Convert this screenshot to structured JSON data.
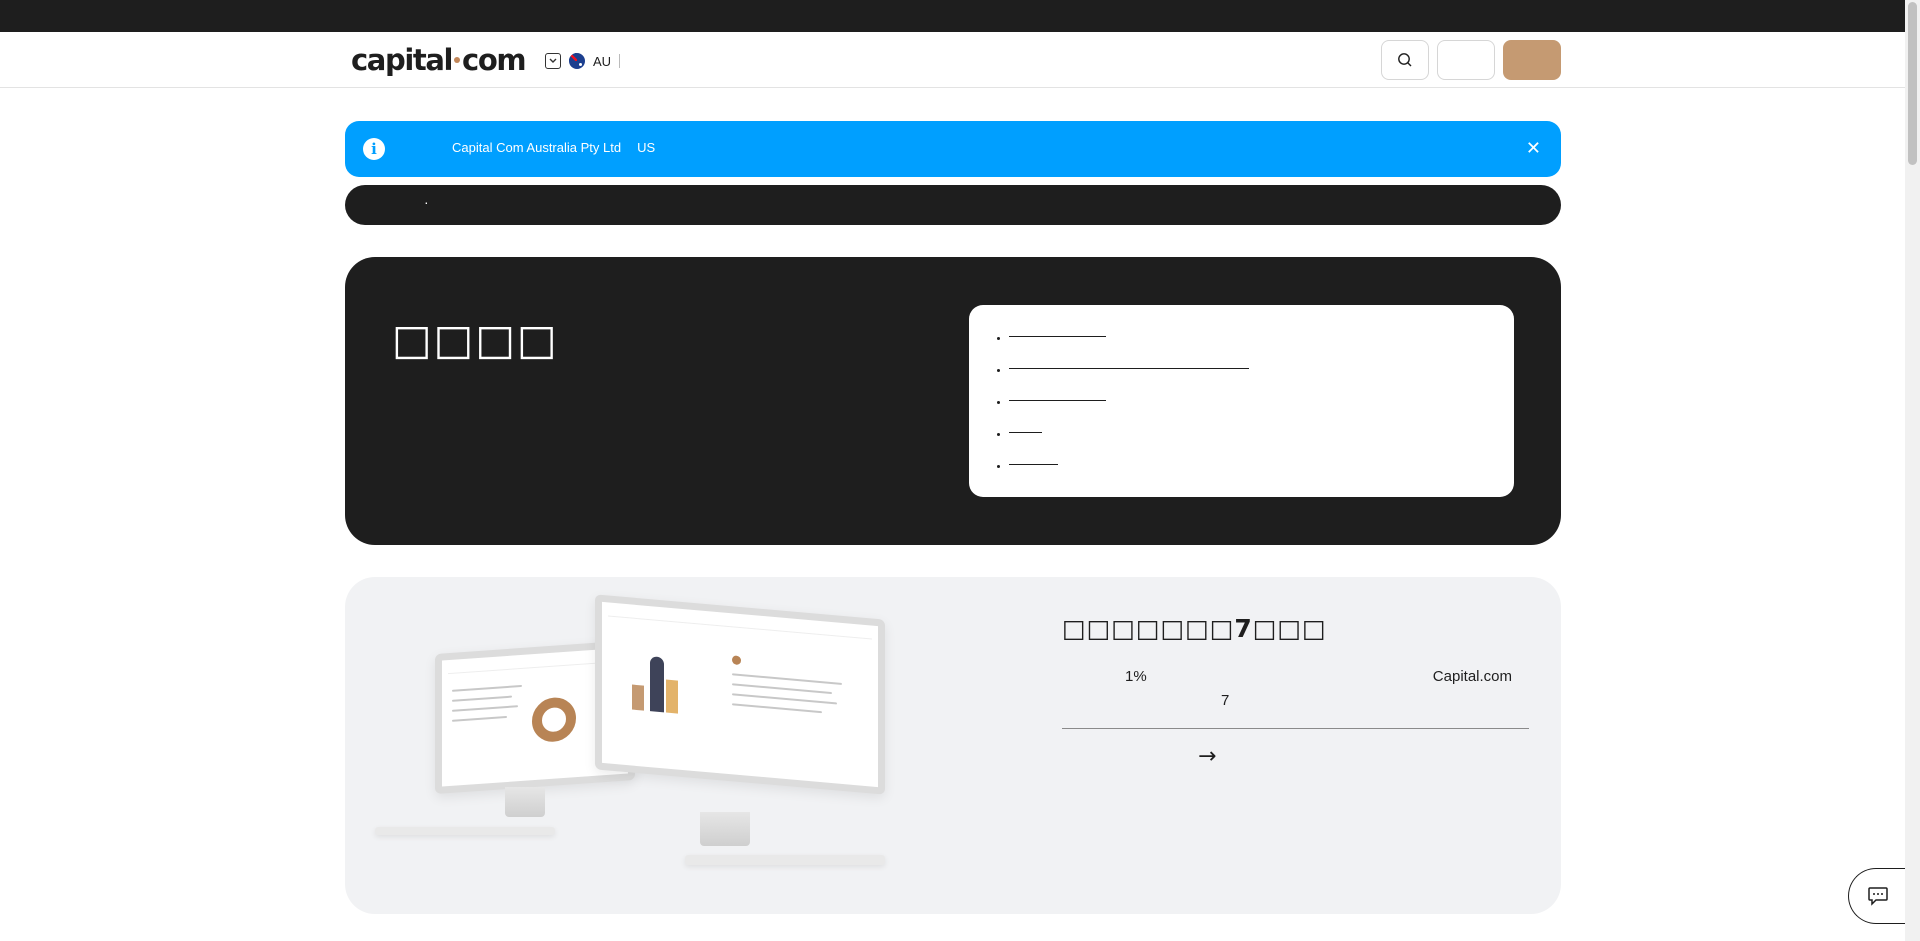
{
  "header": {
    "logo_left": "capital",
    "logo_right": "com",
    "region_code": "AU",
    "icons": {
      "region_toggle": "chevron-down-icon",
      "flag": "australia-flag-icon",
      "search": "search-icon"
    },
    "colors": {
      "signup": "#c59a72",
      "topbar": "#1e1e1e"
    }
  },
  "alert": {
    "company": "Capital Com Australia Pty Ltd",
    "country": "US",
    "close_label": "✕",
    "color": "#009fff"
  },
  "darkbar": {
    "marker": "·"
  },
  "hero": {
    "title": "□□□□",
    "toc": [
      "",
      "",
      "",
      "",
      ""
    ]
  },
  "promo": {
    "title": "□□□□□□□7□□□",
    "percent": "1%",
    "brand": "Capital.com",
    "days": "7",
    "arrow": "→"
  },
  "chat": {
    "icon": "chat-icon"
  }
}
